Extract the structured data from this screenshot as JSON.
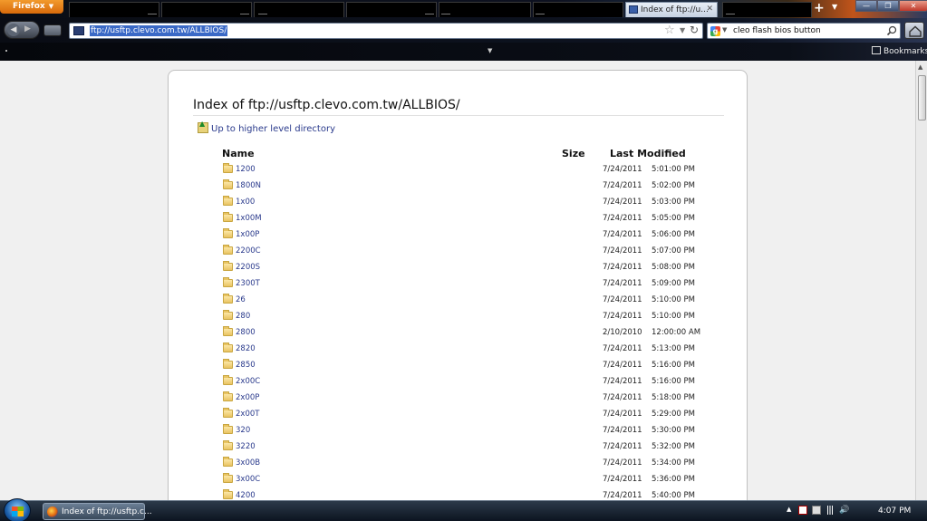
{
  "browser": {
    "app_button_label": "Firefox",
    "active_tab_title": "Index of ftp://u...",
    "active_tab_close": "✕",
    "new_tab": "+",
    "address": "ftp://usftp.clevo.com.tw/ALLBIOS/",
    "search_query": "cleo flash bios button",
    "bookmarks_label": "Bookmarks"
  },
  "page": {
    "heading": "Index of ftp://usftp.clevo.com.tw/ALLBIOS/",
    "up_link": "Up to higher level directory",
    "columns": {
      "name": "Name",
      "size": "Size",
      "modified": "Last Modified"
    },
    "entries": [
      {
        "name": "1200",
        "date": "7/24/2011",
        "time": "5:01:00 PM"
      },
      {
        "name": "1800N",
        "date": "7/24/2011",
        "time": "5:02:00 PM"
      },
      {
        "name": "1x00",
        "date": "7/24/2011",
        "time": "5:03:00 PM"
      },
      {
        "name": "1x00M",
        "date": "7/24/2011",
        "time": "5:05:00 PM"
      },
      {
        "name": "1x00P",
        "date": "7/24/2011",
        "time": "5:06:00 PM"
      },
      {
        "name": "2200C",
        "date": "7/24/2011",
        "time": "5:07:00 PM"
      },
      {
        "name": "2200S",
        "date": "7/24/2011",
        "time": "5:08:00 PM"
      },
      {
        "name": "2300T",
        "date": "7/24/2011",
        "time": "5:09:00 PM"
      },
      {
        "name": "26",
        "date": "7/24/2011",
        "time": "5:10:00 PM"
      },
      {
        "name": "280",
        "date": "7/24/2011",
        "time": "5:10:00 PM"
      },
      {
        "name": "2800",
        "date": "2/10/2010",
        "time": "12:00:00 AM"
      },
      {
        "name": "2820",
        "date": "7/24/2011",
        "time": "5:13:00 PM"
      },
      {
        "name": "2850",
        "date": "7/24/2011",
        "time": "5:16:00 PM"
      },
      {
        "name": "2x00C",
        "date": "7/24/2011",
        "time": "5:16:00 PM"
      },
      {
        "name": "2x00P",
        "date": "7/24/2011",
        "time": "5:18:00 PM"
      },
      {
        "name": "2x00T",
        "date": "7/24/2011",
        "time": "5:29:00 PM"
      },
      {
        "name": "320",
        "date": "7/24/2011",
        "time": "5:30:00 PM"
      },
      {
        "name": "3220",
        "date": "7/24/2011",
        "time": "5:32:00 PM"
      },
      {
        "name": "3x00B",
        "date": "7/24/2011",
        "time": "5:34:00 PM"
      },
      {
        "name": "3x00C",
        "date": "7/24/2011",
        "time": "5:36:00 PM"
      },
      {
        "name": "4200",
        "date": "7/24/2011",
        "time": "5:40:00 PM"
      }
    ]
  },
  "taskbar": {
    "task_label": "Index of ftp://usftp.c...",
    "clock": "4:07 PM"
  },
  "icons": {
    "folder": "folder-icon",
    "up": "up-folder-icon",
    "star": "bookmark-star-icon",
    "reload": "reload-icon",
    "search": "search-icon",
    "home": "home-icon"
  }
}
